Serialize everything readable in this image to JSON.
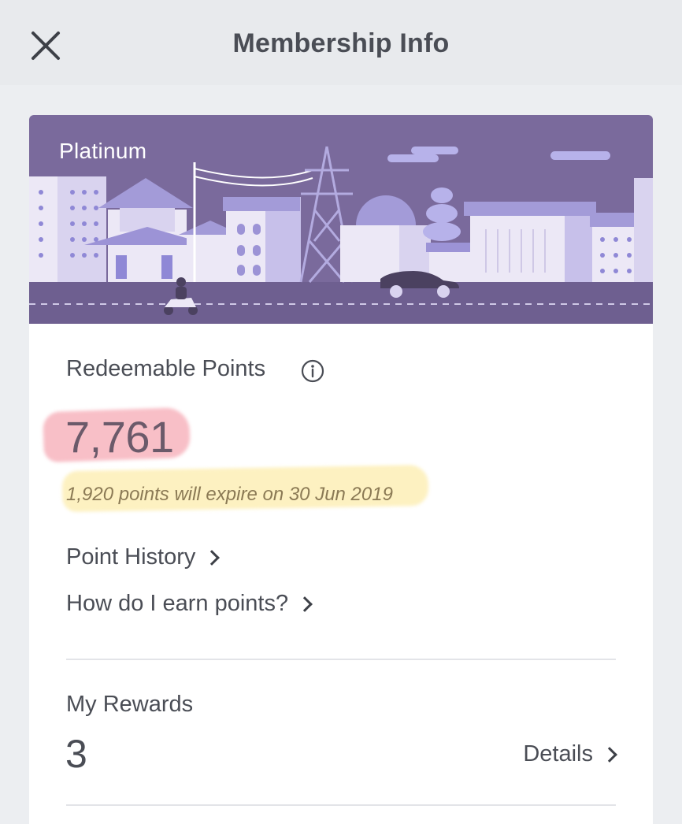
{
  "header": {
    "title": "Membership Info",
    "close_icon": "close-icon"
  },
  "membership": {
    "tier": "Platinum"
  },
  "points": {
    "label": "Redeemable Points",
    "value": "7,761",
    "expire_note": "1,920 points will expire on 30 Jun 2019",
    "info_icon": "info-icon"
  },
  "links": {
    "history": "Point History",
    "earn": "How do I earn points?"
  },
  "rewards": {
    "label": "My Rewards",
    "count": "3",
    "details": "Details"
  },
  "colors": {
    "banner": "#7a6a9c",
    "building_light": "#ece8f6",
    "building_accent": "#a39bd8",
    "pink_highlight": "#f6aab4",
    "yellow_highlight": "#fceeb2"
  }
}
